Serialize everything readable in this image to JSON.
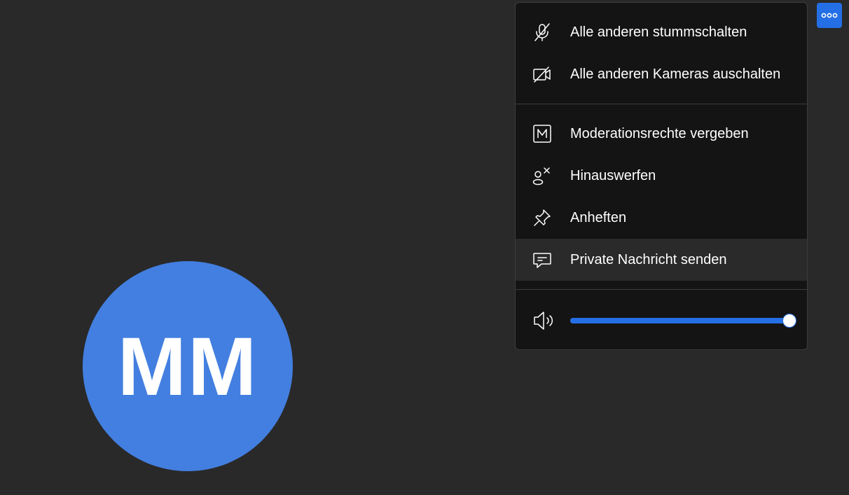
{
  "participant": {
    "initials": "MM",
    "avatar_color": "#437fe0"
  },
  "toolbar": {
    "more_button_icon": "more-horizontal-icon",
    "accent_color": "#246fe5"
  },
  "menu": {
    "items": [
      {
        "label": "Alle anderen stummschalten",
        "icon": "mic-off-icon"
      },
      {
        "label": "Alle anderen Kameras auschalten",
        "icon": "camera-off-icon"
      },
      {
        "label": "Moderationsrechte vergeben",
        "icon": "moderator-icon"
      },
      {
        "label": "Hinauswerfen",
        "icon": "kick-user-icon"
      },
      {
        "label": "Anheften",
        "icon": "pin-icon"
      },
      {
        "label": "Private Nachricht senden",
        "icon": "private-message-icon"
      }
    ],
    "highlighted_item": "Private Nachricht senden",
    "volume": {
      "icon": "speaker-icon",
      "level": 1.0
    }
  }
}
